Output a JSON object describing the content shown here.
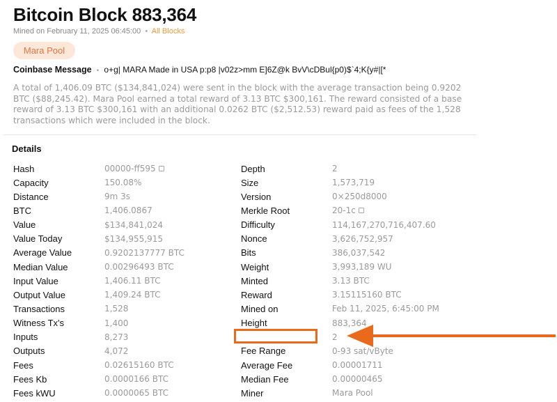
{
  "header": {
    "title": "Bitcoin Block",
    "block_number": "883,364",
    "mined_on": "Mined on February 11, 2025 06:45:00",
    "separator": "•",
    "all_blocks_link": "All Blocks",
    "pool_badge": "Mara Pool"
  },
  "coinbase": {
    "label": "Coinbase Message",
    "bullet": "•",
    "message": "o+g| MARA Made in USA p:p8 |v02z>mm E]6Z@k BvV\\cDBul{p0)$`4;K{y#|[*"
  },
  "summary": "A total of 1,406.09 BTC ($134,841,024) were sent in the block with the average transaction being 0.9202 BTC ($88,245.42). Mara Pool earned a total reward of 3.13 BTC $300,161. The reward consisted of a base reward of 3.13 BTC $300,161 with an additional 0.0262 BTC ($2,512.53) reward paid as fees of the 1,528 transactions which were included in the block.",
  "details": {
    "heading": "Details",
    "left": [
      {
        "key": "Hash",
        "value": "00000-ff595"
      },
      {
        "key": "Capacity",
        "value": "150.08%"
      },
      {
        "key": "Distance",
        "value": "9m 3s"
      },
      {
        "key": "BTC",
        "value": "1,406.0867"
      },
      {
        "key": "Value",
        "value": "$134,841,024"
      },
      {
        "key": "Value Today",
        "value": "$134,955,915"
      },
      {
        "key": "Average Value",
        "value": "0.9202137777 BTC"
      },
      {
        "key": "Median Value",
        "value": "0.00296493 BTC"
      },
      {
        "key": "Input Value",
        "value": "1,406.11 BTC"
      },
      {
        "key": "Output Value",
        "value": "1,409.24 BTC"
      },
      {
        "key": "Transactions",
        "value": "1,528"
      },
      {
        "key": "Witness Tx's",
        "value": "1,400"
      },
      {
        "key": "Inputs",
        "value": "8,273"
      },
      {
        "key": "Outputs",
        "value": "4,072"
      },
      {
        "key": "Fees",
        "value": "0.02615160 BTC"
      },
      {
        "key": "Fees Kb",
        "value": "0.0000166 BTC"
      },
      {
        "key": "Fees kWU",
        "value": "0.0000065 BTC"
      }
    ],
    "right": [
      {
        "key": "Depth",
        "value": "2"
      },
      {
        "key": "Size",
        "value": "1,573,719"
      },
      {
        "key": "Version",
        "value": "0×250d8000"
      },
      {
        "key": "Merkle Root",
        "value": "20-1c"
      },
      {
        "key": "Difficulty",
        "value": "114,167,270,716,407.60"
      },
      {
        "key": "Nonce",
        "value": "3,626,752,957"
      },
      {
        "key": "Bits",
        "value": "386,037,542"
      },
      {
        "key": "Weight",
        "value": "3,993,189 WU"
      },
      {
        "key": "Minted",
        "value": "3.13 BTC"
      },
      {
        "key": "Reward",
        "value": "3.15115160 BTC"
      },
      {
        "key": "Mined on",
        "value": "Feb 11, 2025, 6:45:00 PM"
      },
      {
        "key": "Height",
        "value": "883,364"
      },
      {
        "key": "",
        "value": "2"
      },
      {
        "key": "Fee Range",
        "value": "0-93 sat/vByte"
      },
      {
        "key": "Average Fee",
        "value": "0.00001711"
      },
      {
        "key": "Median Fee",
        "value": "0.00000465"
      },
      {
        "key": "Miner",
        "value": "Mara Pool"
      }
    ]
  },
  "colors": {
    "accent": "#ea6a1c",
    "badge_bg": "#fde7d9",
    "badge_text": "#e8753f",
    "muted_text": "#9a9a9a"
  },
  "icons": {
    "copy": "copy-icon",
    "annotation_arrow": "arrow-left-icon"
  }
}
